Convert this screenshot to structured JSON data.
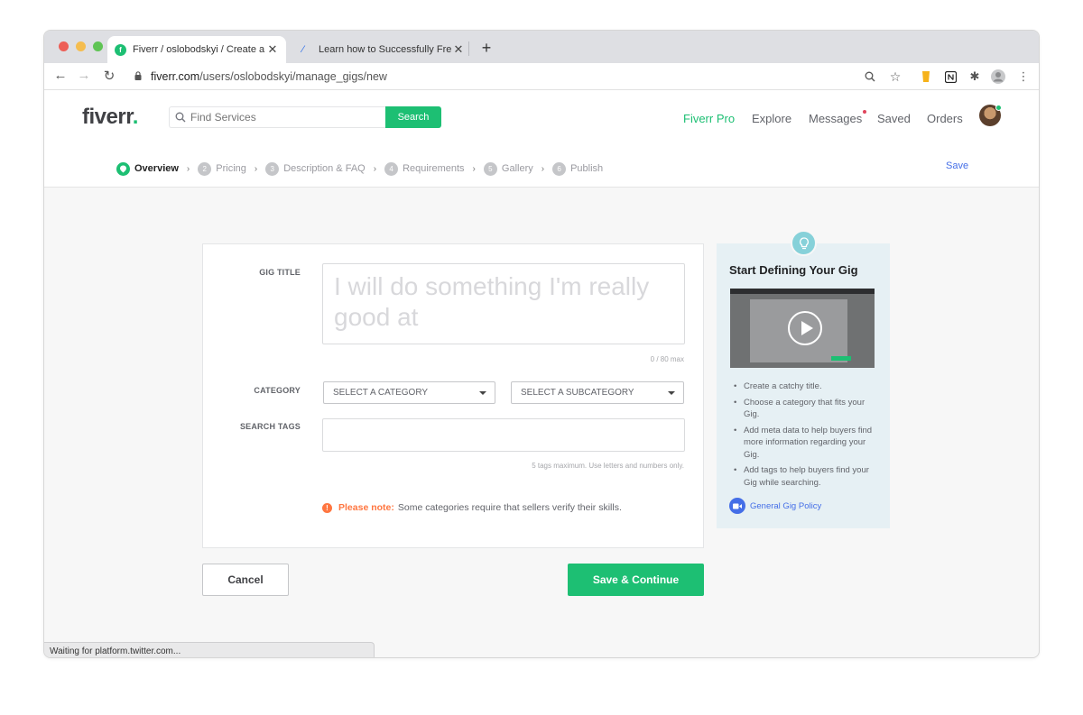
{
  "browser": {
    "tabs": [
      {
        "title": "Fiverr / oslobodskyi / Create a",
        "active": true
      },
      {
        "title": "Learn how to Successfully Fre",
        "active": false
      }
    ],
    "url_host": "fiverr.com",
    "url_path": "/users/oslobodskyi/manage_gigs/new",
    "status_text": "Waiting for platform.twitter.com..."
  },
  "header": {
    "logo": "fiverr",
    "logo_dot": ".",
    "search_placeholder": "Find Services",
    "search_button": "Search",
    "nav": {
      "pro": "Fiverr Pro",
      "explore": "Explore",
      "messages": "Messages",
      "saved": "Saved",
      "orders": "Orders"
    }
  },
  "steps": [
    {
      "num": "1",
      "label": "Overview"
    },
    {
      "num": "2",
      "label": "Pricing"
    },
    {
      "num": "3",
      "label": "Description & FAQ"
    },
    {
      "num": "4",
      "label": "Requirements"
    },
    {
      "num": "5",
      "label": "Gallery"
    },
    {
      "num": "6",
      "label": "Publish"
    }
  ],
  "save_label": "Save",
  "form": {
    "gig_title_label": "GIG TITLE",
    "gig_title_placeholder": "I will do something I'm really good at",
    "counter": "0 / 80 max",
    "category_label": "CATEGORY",
    "category_select": "SELECT A CATEGORY",
    "subcategory_select": "SELECT A SUBCATEGORY",
    "tags_label": "SEARCH TAGS",
    "tags_hint": "5 tags maximum. Use letters and numbers only.",
    "note_strong": "Please note:",
    "note_text": "Some categories require that sellers verify their skills."
  },
  "buttons": {
    "cancel": "Cancel",
    "save_continue": "Save & Continue"
  },
  "side_panel": {
    "title": "Start Defining Your Gig",
    "tips": [
      "Create a catchy title.",
      "Choose a category that fits your Gig.",
      "Add meta data to help buyers find more information regarding your Gig.",
      "Add tags to help buyers find your Gig while searching."
    ],
    "policy_link": "General Gig Policy"
  },
  "colors": {
    "brand_green": "#1dbf73",
    "link_blue": "#446ee7",
    "note_orange": "#ff7640"
  }
}
